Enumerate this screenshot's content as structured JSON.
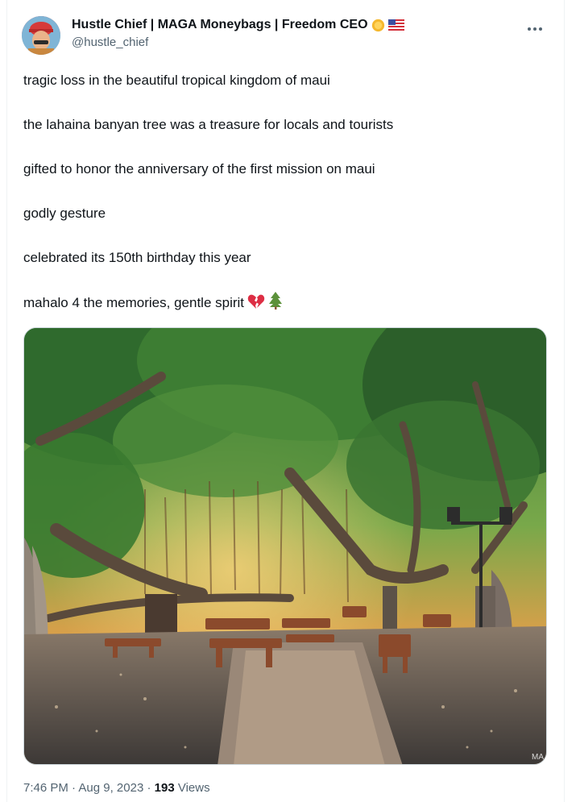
{
  "author": {
    "display_name": "Hustle Chief | MAGA Moneybags | Freedom CEO",
    "handle": "@hustle_chief",
    "badge_icon": "sun-emoji-icon",
    "flag_icon": "us-flag-emoji-icon"
  },
  "tweet": {
    "lines": [
      "tragic loss in the beautiful tropical kingdom of maui",
      "the lahaina banyan tree was a treasure for locals and tourists",
      "gifted to honor the anniversary of the first mission on maui",
      "godly gesture",
      "celebrated its 150th birthday this year",
      "mahalo 4 the memories, gentle spirit"
    ],
    "trailing_emojis": [
      "broken-heart-icon",
      "evergreen-tree-icon"
    ]
  },
  "media": {
    "watermark": "MA"
  },
  "meta": {
    "time": "7:46 PM",
    "date": "Aug 9, 2023",
    "separator": "·",
    "views_count": "193",
    "views_label": "Views"
  },
  "colors": {
    "text": "#0f1419",
    "secondary": "#536471",
    "border": "#cfd9de"
  }
}
